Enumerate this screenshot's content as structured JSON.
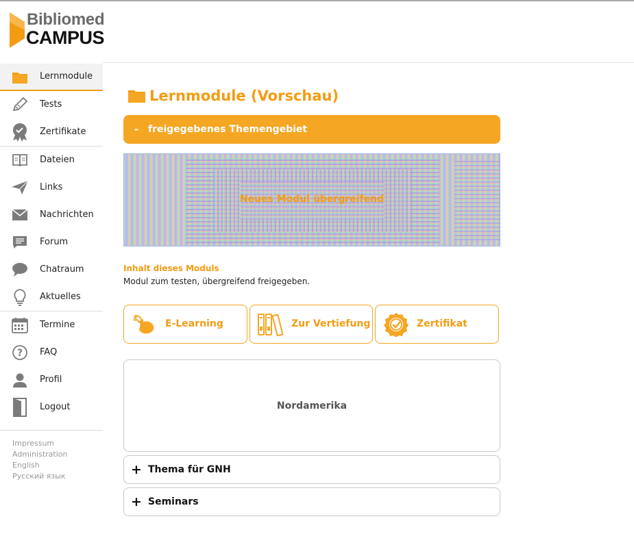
{
  "brand": {
    "line1": "Bibliomed",
    "line2": "CAMPUS"
  },
  "colors": {
    "accent": "#f39c12",
    "accent_bar": "#f5a623",
    "icon_gray": "#7b7b7b"
  },
  "sidebar": {
    "items": [
      {
        "label": "Lernmodule",
        "icon": "folder-icon",
        "active": true
      },
      {
        "label": "Tests",
        "icon": "pencil-icon"
      },
      {
        "label": "Zertifikate",
        "icon": "certificate-icon"
      },
      {
        "label": "Dateien",
        "icon": "book-icon"
      },
      {
        "label": "Links",
        "icon": "paper-plane-icon"
      },
      {
        "label": "Nachrichten",
        "icon": "envelope-icon"
      },
      {
        "label": "Forum",
        "icon": "forum-icon"
      },
      {
        "label": "Chatraum",
        "icon": "chat-bubble-icon"
      },
      {
        "label": "Aktuelles",
        "icon": "lightbulb-icon"
      },
      {
        "label": "Termine",
        "icon": "calendar-icon"
      },
      {
        "label": "FAQ",
        "icon": "question-icon"
      },
      {
        "label": "Profil",
        "icon": "user-icon"
      },
      {
        "label": "Logout",
        "icon": "door-icon"
      }
    ],
    "footer": [
      "Impressum",
      "Administration",
      "English",
      "Русский язык"
    ]
  },
  "main": {
    "title": "Lernmodule (Vorschau)",
    "theme_bar": {
      "sign": "-",
      "label": "freigegebenes Themengebiet"
    },
    "banner_caption": "Neues Modul übergreifend",
    "content_heading": "Inhalt dieses Moduls",
    "content_desc": "Modul zum testen, übergreifend freigegeben.",
    "buttons": [
      {
        "label": "E-Learning",
        "icon": "mouse-hand-icon"
      },
      {
        "label": "Zur Vertiefung",
        "icon": "binders-icon"
      },
      {
        "label": "Zertifikat",
        "icon": "badge-check-icon"
      }
    ],
    "card": {
      "label": "Nordamerika"
    },
    "accordion": [
      {
        "sign": "+",
        "label": "Thema für GNH"
      },
      {
        "sign": "+",
        "label": "Seminars"
      }
    ]
  }
}
